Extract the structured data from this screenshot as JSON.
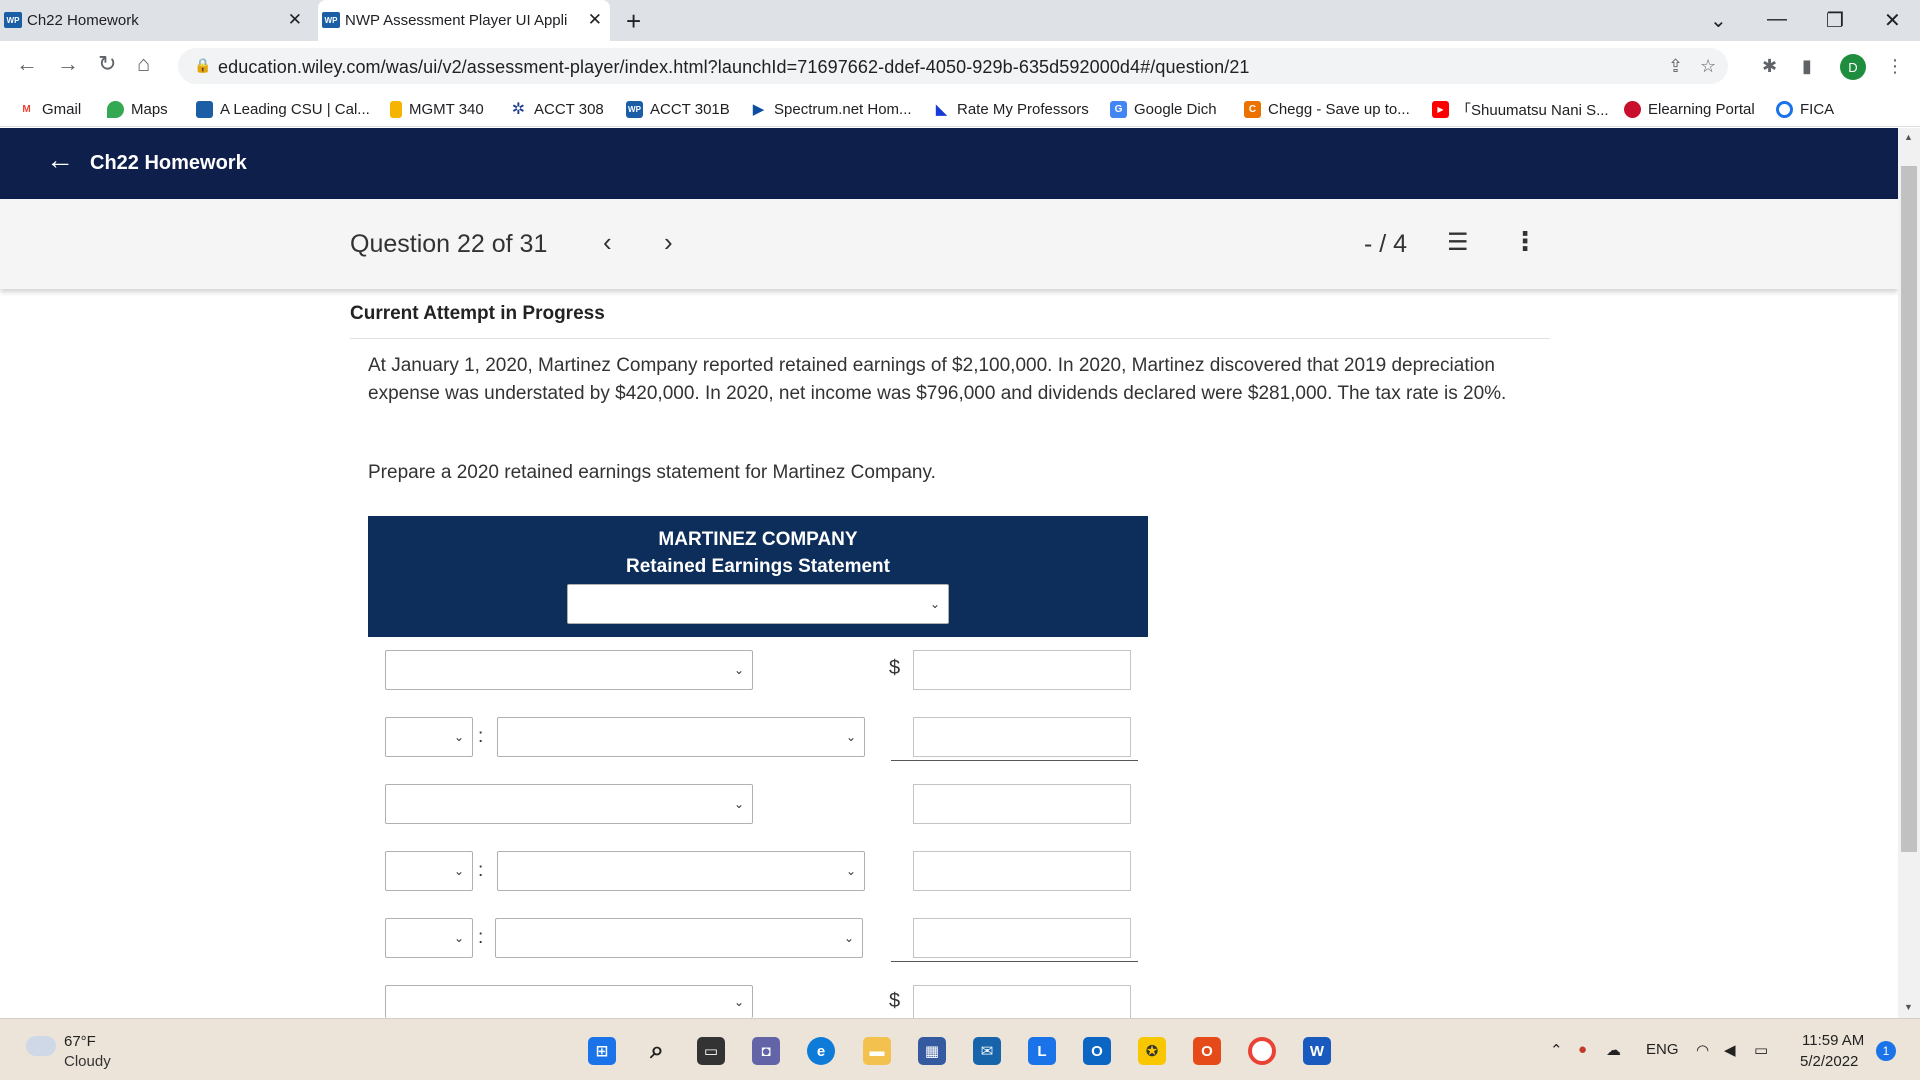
{
  "browser": {
    "tabs": [
      {
        "label": "Ch22 Homework",
        "favicon": "WP"
      },
      {
        "label": "NWP Assessment Player UI Appli",
        "favicon": "WP"
      }
    ],
    "url": "education.wiley.com/was/ui/v2/assessment-player/index.html?launchId=71697662-ddef-4050-929b-635d592000d4#/question/21",
    "profile_initial": "D"
  },
  "bookmarks": [
    {
      "label": "Gmail",
      "icon": "gmail-icon",
      "color": "#ea4335"
    },
    {
      "label": "Maps",
      "icon": "maps-icon",
      "color": "#34a853"
    },
    {
      "label": "A Leading CSU | Cal...",
      "icon": "csu-icon",
      "color": "#1b5ea6"
    },
    {
      "label": "MGMT 340",
      "icon": "bookmark-icon",
      "color": "#f4b400"
    },
    {
      "label": "ACCT 308",
      "icon": "sparkle-icon",
      "color": "#1b3a8a"
    },
    {
      "label": "ACCT 301B",
      "icon": "wp-icon",
      "color": "#1b5ea6"
    },
    {
      "label": "Spectrum.net Hom...",
      "icon": "play-icon",
      "color": "#0b4ea2"
    },
    {
      "label": "Rate My Professors",
      "icon": "flag-icon",
      "color": "#1a3ad8"
    },
    {
      "label": "Google Dich",
      "icon": "translate-icon",
      "color": "#4285f4"
    },
    {
      "label": "Chegg - Save up to...",
      "icon": "chegg-icon",
      "color": "#eb7100"
    },
    {
      "label": "「Shuumatsu Nani S...",
      "icon": "youtube-icon",
      "color": "#ff0000"
    },
    {
      "label": "Elearning Portal",
      "icon": "apple-icon",
      "color": "#c8102e"
    },
    {
      "label": "FICA",
      "icon": "search-circle-icon",
      "color": "#1a73e8"
    }
  ],
  "header": {
    "title": "Ch22 Homework"
  },
  "question_bar": {
    "question_label": "Question 22 of 31",
    "score": "- / 4"
  },
  "content": {
    "attempt_label": "Current Attempt in Progress",
    "problem_text": "At January 1, 2020, Martinez Company reported retained earnings of $2,100,000. In 2020, Martinez discovered that 2019 depreciation expense was understated by $420,000. In 2020, net income was $796,000 and dividends declared were $281,000. The tax rate is 20%.",
    "instruction": "Prepare a 2020 retained earnings statement for Martinez Company.",
    "statement": {
      "company": "MARTINEZ COMPANY",
      "title": "Retained Earnings Statement",
      "currency_symbol": "$",
      "colon": ":"
    }
  },
  "taskbar": {
    "temperature": "67°F",
    "condition": "Cloudy",
    "language": "ENG",
    "time": "11:59 AM",
    "date": "5/2/2022",
    "notification_count": "1"
  }
}
